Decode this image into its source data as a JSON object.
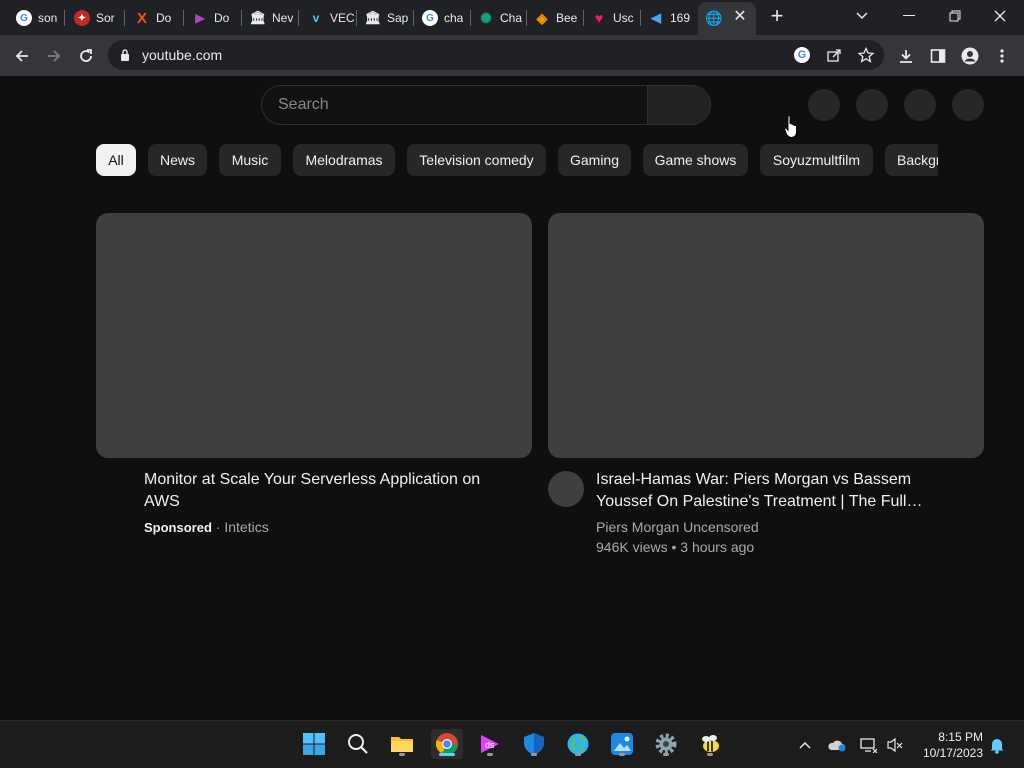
{
  "browser": {
    "tabs": [
      {
        "label": "son",
        "icon": "google-icon",
        "color": "#ffffff"
      },
      {
        "label": "Sor",
        "icon": "sort-icon",
        "color": "#e53935"
      },
      {
        "label": "Do",
        "icon": "x-icon",
        "color": "#f4511e"
      },
      {
        "label": "Do",
        "icon": "play-icon",
        "color": "#7e57c2"
      },
      {
        "label": "Nev",
        "icon": "bank-icon",
        "color": "#e8eaed"
      },
      {
        "label": "VEC",
        "icon": "v-icon",
        "color": "#4fc3f7"
      },
      {
        "label": "Sap",
        "icon": "bank-icon",
        "color": "#e8eaed"
      },
      {
        "label": "cha",
        "icon": "google-icon",
        "color": "#ffffff"
      },
      {
        "label": "Cha",
        "icon": "chatgpt-icon",
        "color": "#10a37f"
      },
      {
        "label": "Bee",
        "icon": "diamond-icon",
        "color": "#ff9800"
      },
      {
        "label": "Usc",
        "icon": "heart-icon",
        "color": "#e91e63"
      },
      {
        "label": "169",
        "icon": "fish-icon",
        "color": "#42a5f5"
      },
      {
        "label": "",
        "icon": "globe-icon",
        "color": "#9aa0a6"
      }
    ],
    "url": "youtube.com"
  },
  "youtube": {
    "search_placeholder": "Search",
    "chips": [
      "All",
      "News",
      "Music",
      "Melodramas",
      "Television comedy",
      "Gaming",
      "Game shows",
      "Soyuzmultfilm",
      "Background"
    ],
    "videos": [
      {
        "title_line1": "Monitor at Scale Your Serverless Application on",
        "title_line2": "AWS",
        "sponsored": "Sponsored",
        "separator": " · ",
        "channel": "Intetics"
      },
      {
        "title_line1": "Israel-Hamas War: Piers Morgan vs Bassem",
        "title_line2": "Youssef On Palestine's Treatment | The Full…",
        "channel": "Piers Morgan Uncensored",
        "stats": "946K views • 3 hours ago"
      }
    ]
  },
  "taskbar": {
    "time": "8:15 PM",
    "date": "10/17/2023"
  }
}
